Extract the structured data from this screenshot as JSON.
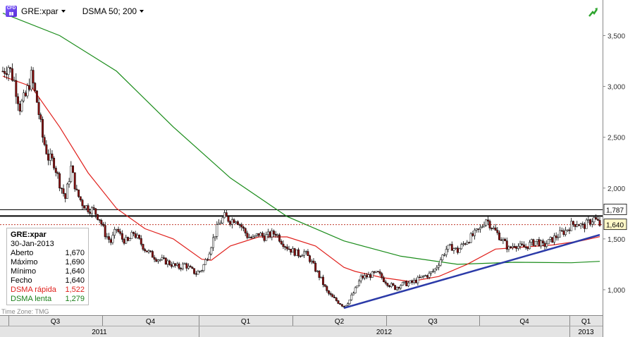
{
  "toolbar": {
    "symbol": "GRE:xpar",
    "indicator": "DSMA 50; 200"
  },
  "legend": {
    "name": "GRE:xpar",
    "date": "30-Jan-2013",
    "rows": [
      {
        "label": "Aberto",
        "value": "1,670",
        "color": "#000000"
      },
      {
        "label": "Máximo",
        "value": "1,690",
        "color": "#000000"
      },
      {
        "label": "Mínimo",
        "value": "1,640",
        "color": "#000000"
      },
      {
        "label": "Fecho",
        "value": "1,640",
        "color": "#000000"
      },
      {
        "label": "DSMA rápida",
        "value": "1,522",
        "color": "#e0201c"
      },
      {
        "label": "DSMA lenta",
        "value": "1,279",
        "color": "#1a7f1a"
      }
    ]
  },
  "footer": {
    "timezone": "Time Zone: TMG"
  },
  "icons": {
    "logo": "cfd-logo-icon",
    "trend": "trend-up-arrow-icon"
  },
  "chart_data": {
    "type": "candlestick",
    "ylim": [
      750,
      3850
    ],
    "y_ticks": [
      "1,000",
      "1,500",
      "2,000",
      "2,500",
      "3,000",
      "3,500"
    ],
    "y_tick_values": [
      1000,
      1500,
      2000,
      2500,
      3000,
      3500
    ],
    "price_labels": [
      {
        "text": "1,787",
        "value": 1787
      },
      {
        "text": "1,640",
        "value": 1640
      }
    ],
    "quarters": [
      "Q3",
      "Q4",
      "Q1",
      "Q2",
      "Q3",
      "Q4",
      "Q1"
    ],
    "years": [
      "2011",
      "2012",
      "2013"
    ],
    "close_path": [
      [
        0,
        3150
      ],
      [
        3,
        3200
      ],
      [
        6,
        3050
      ],
      [
        9,
        2800
      ],
      [
        12,
        2900
      ],
      [
        15,
        3100
      ],
      [
        18,
        2850
      ],
      [
        21,
        2500
      ],
      [
        24,
        2300
      ],
      [
        27,
        2250
      ],
      [
        30,
        2050
      ],
      [
        33,
        1900
      ],
      [
        36,
        2200
      ],
      [
        39,
        1950
      ],
      [
        42,
        1850
      ],
      [
        45,
        1800
      ],
      [
        48,
        1780
      ],
      [
        51,
        1700
      ],
      [
        54,
        1550
      ],
      [
        57,
        1470
      ],
      [
        60,
        1600
      ],
      [
        63,
        1500
      ],
      [
        66,
        1470
      ],
      [
        69,
        1560
      ],
      [
        72,
        1480
      ],
      [
        75,
        1400
      ],
      [
        78,
        1350
      ],
      [
        81,
        1310
      ],
      [
        84,
        1290
      ],
      [
        87,
        1270
      ],
      [
        90,
        1240
      ],
      [
        93,
        1220
      ],
      [
        96,
        1250
      ],
      [
        99,
        1200
      ],
      [
        102,
        1160
      ],
      [
        105,
        1200
      ],
      [
        108,
        1330
      ],
      [
        111,
        1500
      ],
      [
        114,
        1650
      ],
      [
        117,
        1720
      ],
      [
        120,
        1680
      ],
      [
        123,
        1700
      ],
      [
        126,
        1620
      ],
      [
        129,
        1530
      ],
      [
        132,
        1500
      ],
      [
        135,
        1550
      ],
      [
        138,
        1520
      ],
      [
        141,
        1540
      ],
      [
        144,
        1560
      ],
      [
        147,
        1480
      ],
      [
        150,
        1420
      ],
      [
        153,
        1380
      ],
      [
        156,
        1350
      ],
      [
        159,
        1370
      ],
      [
        162,
        1300
      ],
      [
        165,
        1200
      ],
      [
        168,
        1100
      ],
      [
        171,
        980
      ],
      [
        174,
        920
      ],
      [
        177,
        880
      ],
      [
        180,
        840
      ],
      [
        183,
        900
      ],
      [
        186,
        1000
      ],
      [
        189,
        1120
      ],
      [
        192,
        1130
      ],
      [
        195,
        1150
      ],
      [
        198,
        1160
      ],
      [
        201,
        1100
      ],
      [
        204,
        1050
      ],
      [
        207,
        1020
      ],
      [
        210,
        1050
      ],
      [
        213,
        1060
      ],
      [
        216,
        1070
      ],
      [
        219,
        1100
      ],
      [
        222,
        1130
      ],
      [
        225,
        1150
      ],
      [
        228,
        1200
      ],
      [
        231,
        1300
      ],
      [
        234,
        1400
      ],
      [
        237,
        1420
      ],
      [
        240,
        1380
      ],
      [
        243,
        1450
      ],
      [
        246,
        1500
      ],
      [
        249,
        1550
      ],
      [
        252,
        1600
      ],
      [
        255,
        1700
      ],
      [
        258,
        1620
      ],
      [
        261,
        1550
      ],
      [
        264,
        1480
      ],
      [
        267,
        1400
      ],
      [
        270,
        1450
      ],
      [
        273,
        1420
      ],
      [
        276,
        1420
      ],
      [
        279,
        1460
      ],
      [
        282,
        1480
      ],
      [
        285,
        1430
      ],
      [
        288,
        1470
      ],
      [
        291,
        1510
      ],
      [
        294,
        1550
      ],
      [
        297,
        1580
      ],
      [
        300,
        1640
      ],
      [
        303,
        1660
      ],
      [
        306,
        1620
      ],
      [
        309,
        1660
      ],
      [
        312,
        1700
      ],
      [
        315,
        1640
      ]
    ],
    "fast_ma": [
      [
        0,
        3100
      ],
      [
        15,
        3000
      ],
      [
        30,
        2600
      ],
      [
        45,
        2150
      ],
      [
        60,
        1800
      ],
      [
        75,
        1600
      ],
      [
        90,
        1500
      ],
      [
        105,
        1300
      ],
      [
        110,
        1290
      ],
      [
        120,
        1430
      ],
      [
        135,
        1520
      ],
      [
        150,
        1520
      ],
      [
        165,
        1430
      ],
      [
        180,
        1220
      ],
      [
        186,
        1180
      ],
      [
        200,
        1120
      ],
      [
        215,
        1080
      ],
      [
        230,
        1130
      ],
      [
        245,
        1250
      ],
      [
        260,
        1400
      ],
      [
        275,
        1420
      ],
      [
        290,
        1440
      ],
      [
        305,
        1480
      ],
      [
        315,
        1522
      ]
    ],
    "slow_ma": [
      [
        0,
        3720
      ],
      [
        30,
        3500
      ],
      [
        60,
        3150
      ],
      [
        90,
        2600
      ],
      [
        120,
        2100
      ],
      [
        150,
        1720
      ],
      [
        180,
        1480
      ],
      [
        210,
        1330
      ],
      [
        240,
        1250
      ],
      [
        270,
        1270
      ],
      [
        300,
        1265
      ],
      [
        315,
        1279
      ]
    ],
    "trendline": [
      [
        180,
        820
      ],
      [
        315,
        1540
      ]
    ],
    "horizontal_levels": [
      1787,
      1725,
      1640
    ]
  }
}
